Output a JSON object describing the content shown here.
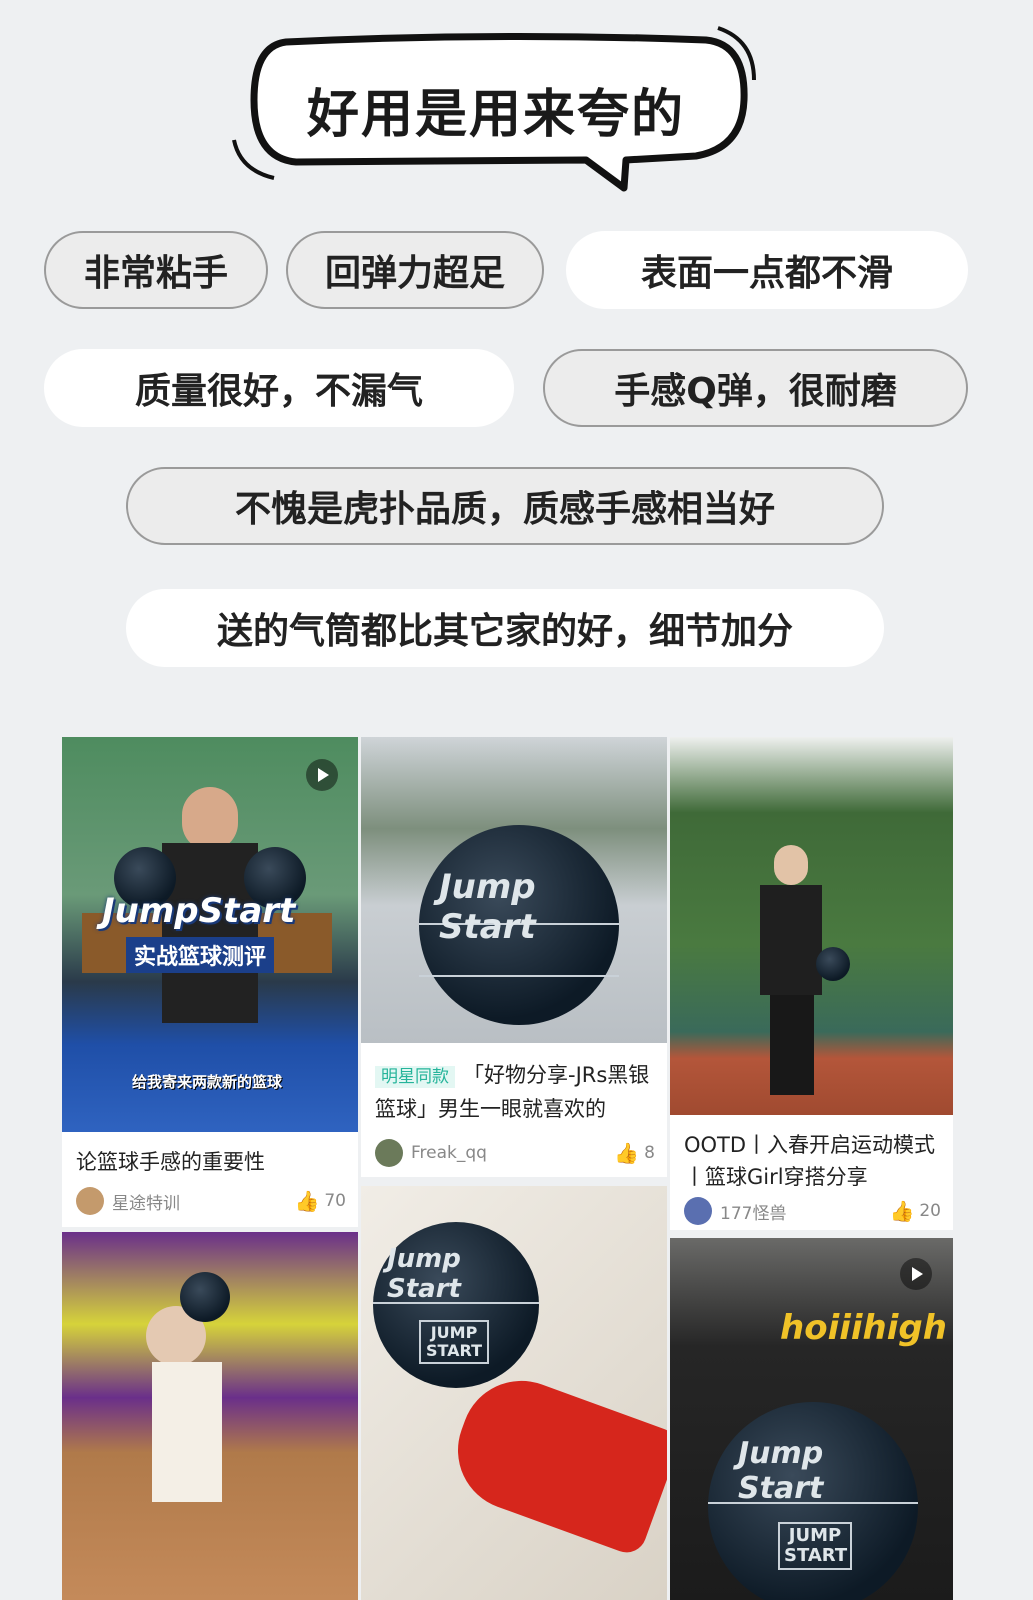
{
  "header": {
    "title": "好用是用来夸的"
  },
  "tags": [
    "非常粘手",
    "回弹力超足",
    "表面一点都不滑",
    "质量很好，不漏气",
    "手感Q弹，很耐磨",
    "不愧是虎扑品质，质感手感相当好",
    "送的气筒都比其它家的好，细节加分"
  ],
  "posts": [
    {
      "overlay_brand": "JumpStart",
      "overlay_subtitle": "实战篮球测评",
      "overlay_note": "给我寄来两款新的篮球",
      "caption": "论篮球手感的重要性",
      "author": "星途特训",
      "likes": "70"
    },
    {
      "ball_text": "Jump Start",
      "badge": "明星同款",
      "caption": "「好物分享-JRs黑银篮球」男生一眼就喜欢的",
      "author": "Freak_qq",
      "likes": "8"
    },
    {
      "caption": "OOTD丨入春开启运动模式丨篮球Girl穿搭分享",
      "author": "177怪兽",
      "likes": "20"
    },
    {},
    {
      "ball_text": "Jump Start",
      "ball_label": "JUMP START"
    },
    {
      "shirt_text": "hoiiihigh",
      "ball_text": "Jump Start",
      "ball_label": "JUMP START"
    }
  ]
}
